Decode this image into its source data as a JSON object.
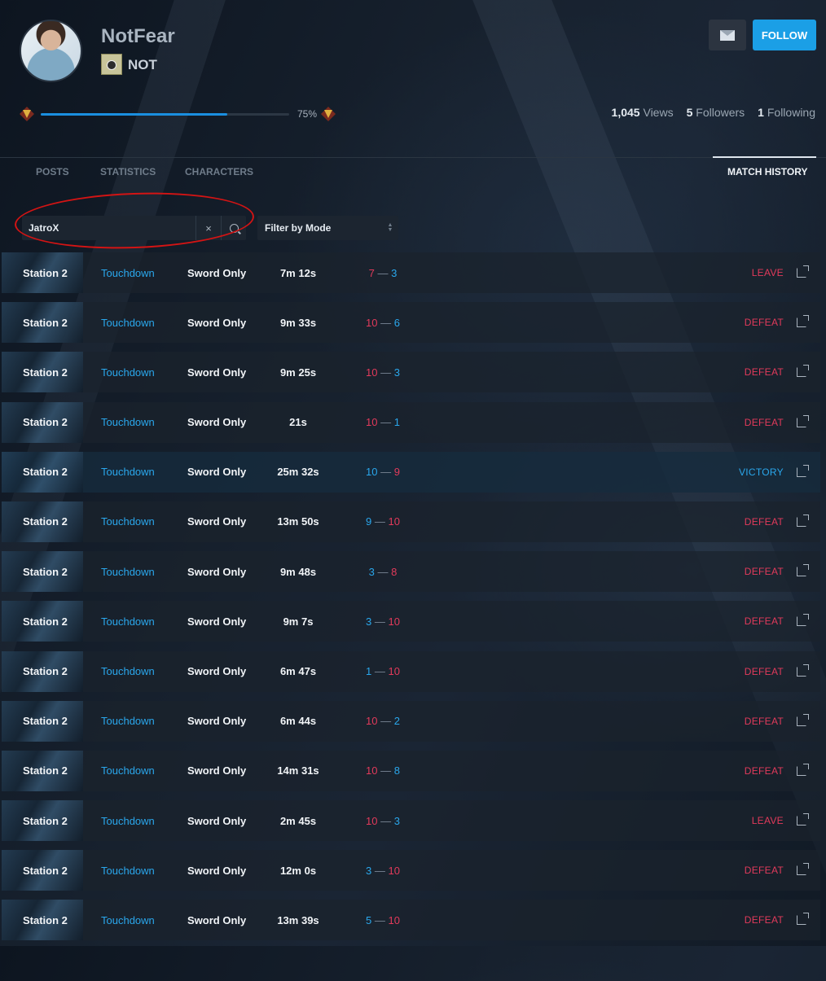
{
  "profile": {
    "username": "NotFear",
    "clan_tag": "NOT",
    "xp_percent_label": "75%",
    "xp_fraction": 0.75,
    "views_count": "1,045",
    "views_label": "Views",
    "followers_count": "5",
    "followers_label": "Followers",
    "following_count": "1",
    "following_label": "Following",
    "follow_label": "FOLLOW"
  },
  "tabs": [
    {
      "label": "POSTS"
    },
    {
      "label": "STATISTICS"
    },
    {
      "label": "CHARACTERS"
    },
    {
      "label": "MATCH HISTORY",
      "active": true
    }
  ],
  "search": {
    "value": "JatroX",
    "clear_label": "×"
  },
  "filter": {
    "label": "Filter by Mode"
  },
  "colors": {
    "accent": "#1b9fe6",
    "loss": "#e23a5b",
    "win": "#2aa7ec",
    "annotation": "#d31414"
  },
  "matches": [
    {
      "map": "Station 2",
      "mode": "Touchdown",
      "type": "Sword Only",
      "duration": "7m 12s",
      "score_a": "7",
      "score_b": "3",
      "a_color": "red",
      "b_color": "blue",
      "result": "LEAVE",
      "win": false
    },
    {
      "map": "Station 2",
      "mode": "Touchdown",
      "type": "Sword Only",
      "duration": "9m 33s",
      "score_a": "10",
      "score_b": "6",
      "a_color": "red",
      "b_color": "blue",
      "result": "DEFEAT",
      "win": false
    },
    {
      "map": "Station 2",
      "mode": "Touchdown",
      "type": "Sword Only",
      "duration": "9m 25s",
      "score_a": "10",
      "score_b": "3",
      "a_color": "red",
      "b_color": "blue",
      "result": "DEFEAT",
      "win": false
    },
    {
      "map": "Station 2",
      "mode": "Touchdown",
      "type": "Sword Only",
      "duration": "21s",
      "score_a": "10",
      "score_b": "1",
      "a_color": "red",
      "b_color": "blue",
      "result": "DEFEAT",
      "win": false
    },
    {
      "map": "Station 2",
      "mode": "Touchdown",
      "type": "Sword Only",
      "duration": "25m 32s",
      "score_a": "10",
      "score_b": "9",
      "a_color": "blue",
      "b_color": "red",
      "result": "VICTORY",
      "win": true
    },
    {
      "map": "Station 2",
      "mode": "Touchdown",
      "type": "Sword Only",
      "duration": "13m 50s",
      "score_a": "9",
      "score_b": "10",
      "a_color": "blue",
      "b_color": "red",
      "result": "DEFEAT",
      "win": false
    },
    {
      "map": "Station 2",
      "mode": "Touchdown",
      "type": "Sword Only",
      "duration": "9m 48s",
      "score_a": "3",
      "score_b": "8",
      "a_color": "blue",
      "b_color": "red",
      "result": "DEFEAT",
      "win": false
    },
    {
      "map": "Station 2",
      "mode": "Touchdown",
      "type": "Sword Only",
      "duration": "9m 7s",
      "score_a": "3",
      "score_b": "10",
      "a_color": "blue",
      "b_color": "red",
      "result": "DEFEAT",
      "win": false
    },
    {
      "map": "Station 2",
      "mode": "Touchdown",
      "type": "Sword Only",
      "duration": "6m 47s",
      "score_a": "1",
      "score_b": "10",
      "a_color": "blue",
      "b_color": "red",
      "result": "DEFEAT",
      "win": false
    },
    {
      "map": "Station 2",
      "mode": "Touchdown",
      "type": "Sword Only",
      "duration": "6m 44s",
      "score_a": "10",
      "score_b": "2",
      "a_color": "red",
      "b_color": "blue",
      "result": "DEFEAT",
      "win": false
    },
    {
      "map": "Station 2",
      "mode": "Touchdown",
      "type": "Sword Only",
      "duration": "14m 31s",
      "score_a": "10",
      "score_b": "8",
      "a_color": "red",
      "b_color": "blue",
      "result": "DEFEAT",
      "win": false
    },
    {
      "map": "Station 2",
      "mode": "Touchdown",
      "type": "Sword Only",
      "duration": "2m 45s",
      "score_a": "10",
      "score_b": "3",
      "a_color": "red",
      "b_color": "blue",
      "result": "LEAVE",
      "win": false
    },
    {
      "map": "Station 2",
      "mode": "Touchdown",
      "type": "Sword Only",
      "duration": "12m 0s",
      "score_a": "3",
      "score_b": "10",
      "a_color": "blue",
      "b_color": "red",
      "result": "DEFEAT",
      "win": false
    },
    {
      "map": "Station 2",
      "mode": "Touchdown",
      "type": "Sword Only",
      "duration": "13m 39s",
      "score_a": "5",
      "score_b": "10",
      "a_color": "blue",
      "b_color": "red",
      "result": "DEFEAT",
      "win": false
    }
  ]
}
